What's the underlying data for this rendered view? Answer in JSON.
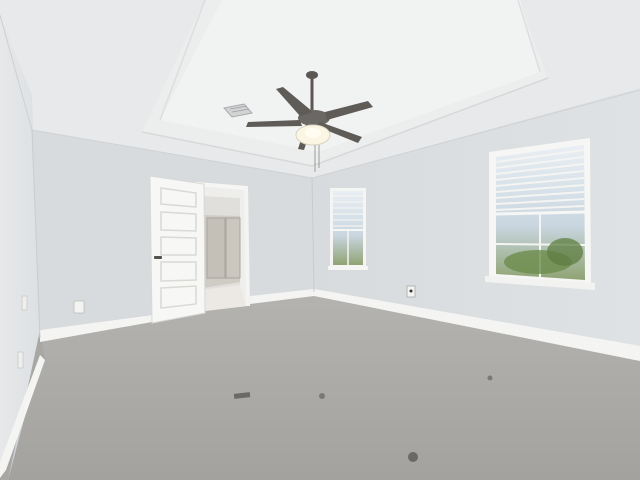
{
  "scene": {
    "description_free": true,
    "palette": {
      "ceiling": "#e9eaeb",
      "tray": "#eeeff0",
      "wall_left": "#e3e5e7",
      "wall_back": "#d7dadc",
      "wall_right": "#d9dcde",
      "carpet": "#a9a8a5",
      "trim": "#f5f5f3",
      "door": "#f7f7f5",
      "fan": "#5a5754",
      "sky": "#dfe8f0",
      "foliage": "#6f8d4e"
    }
  }
}
